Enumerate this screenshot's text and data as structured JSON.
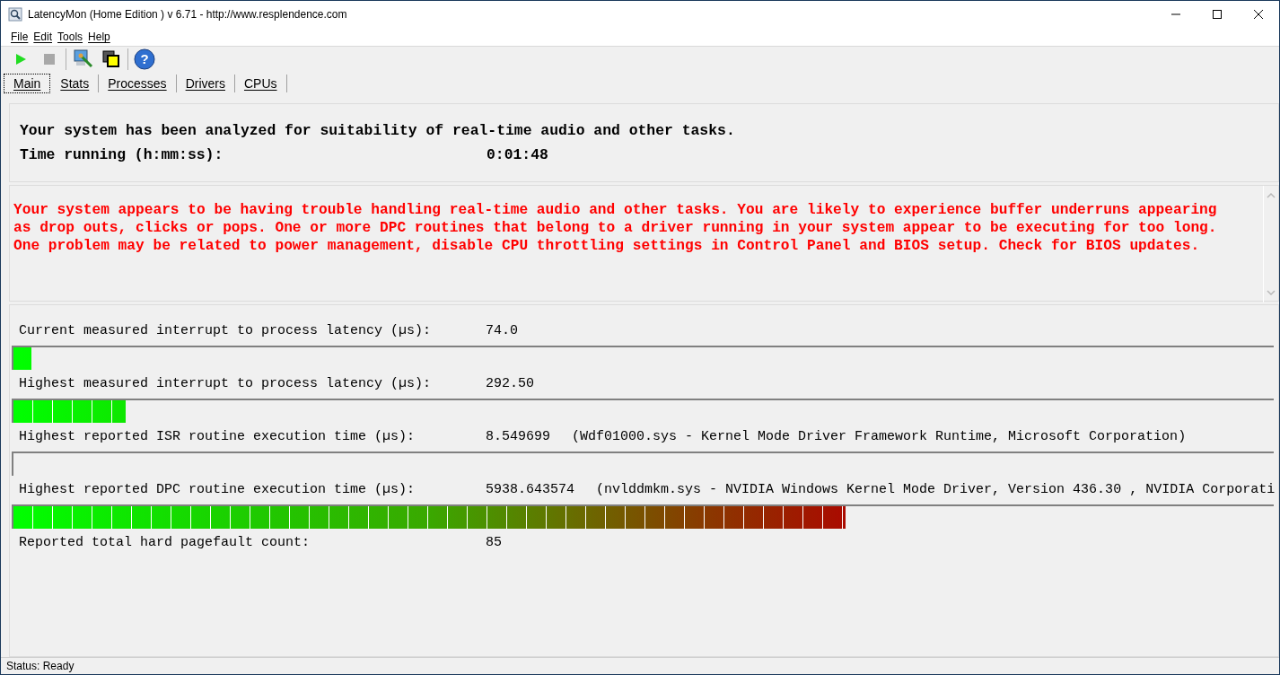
{
  "window": {
    "title": "LatencyMon  (Home Edition )  v 6.71 - http://www.resplendence.com"
  },
  "menu": [
    "File",
    "Edit",
    "Tools",
    "Help"
  ],
  "toolbar": {
    "help_glyph": "?"
  },
  "tabs": [
    {
      "label": "Main",
      "selected": true
    },
    {
      "label": "Stats",
      "selected": false
    },
    {
      "label": "Processes",
      "selected": false
    },
    {
      "label": "Drivers",
      "selected": false
    },
    {
      "label": "CPUs",
      "selected": false
    }
  ],
  "summary": {
    "headline": "Your system has been analyzed for suitability of real-time audio and other tasks.",
    "time_label": "Time running (h:mm:ss):",
    "time_value": "0:01:48"
  },
  "verdict": "Your system appears to be having trouble handling real-time audio and other tasks. You are likely to experience buffer underruns appearing as drop outs, clicks or pops. One or more DPC routines that belong to a driver running in your system appear to be executing for too long. One problem may be related to power management, disable CPU throttling settings in Control Panel and BIOS setup. Check for BIOS updates.",
  "measurements": [
    {
      "label": "Current measured interrupt to process latency (µs):",
      "value": "74.0",
      "level": 0.014
    },
    {
      "label": "Highest measured interrupt to process latency (µs):",
      "value": "292.50",
      "level": 0.089
    },
    {
      "label": "Highest reported ISR routine execution time (µs):",
      "value": "8.549699",
      "detail": "(Wdf01000.sys - Kernel Mode Driver Framework Runtime, Microsoft Corporation)",
      "level": 0
    },
    {
      "label": "Highest reported DPC routine execution time (µs):",
      "value": "5938.643574",
      "detail": "(nvlddmkm.sys - NVIDIA Windows Kernel Mode Driver, Version 436.30 , NVIDIA Corporati",
      "level": 0.66
    },
    {
      "label": "Reported total hard pagefault count:",
      "value": "85"
    }
  ],
  "status_bar": "Status: Ready"
}
